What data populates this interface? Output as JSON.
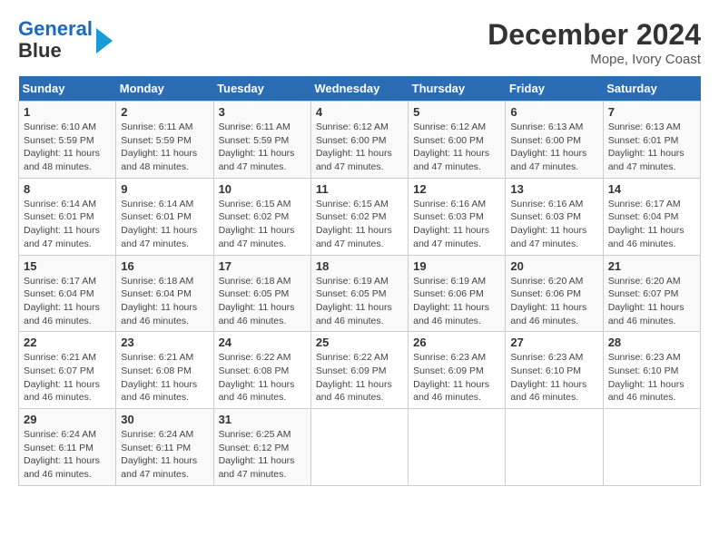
{
  "logo": {
    "line1": "General",
    "line2": "Blue"
  },
  "title": "December 2024",
  "subtitle": "Mope, Ivory Coast",
  "days_header": [
    "Sunday",
    "Monday",
    "Tuesday",
    "Wednesday",
    "Thursday",
    "Friday",
    "Saturday"
  ],
  "weeks": [
    [
      {
        "num": "1",
        "sunrise": "Sunrise: 6:10 AM",
        "sunset": "Sunset: 5:59 PM",
        "daylight": "Daylight: 11 hours and 48 minutes."
      },
      {
        "num": "2",
        "sunrise": "Sunrise: 6:11 AM",
        "sunset": "Sunset: 5:59 PM",
        "daylight": "Daylight: 11 hours and 48 minutes."
      },
      {
        "num": "3",
        "sunrise": "Sunrise: 6:11 AM",
        "sunset": "Sunset: 5:59 PM",
        "daylight": "Daylight: 11 hours and 47 minutes."
      },
      {
        "num": "4",
        "sunrise": "Sunrise: 6:12 AM",
        "sunset": "Sunset: 6:00 PM",
        "daylight": "Daylight: 11 hours and 47 minutes."
      },
      {
        "num": "5",
        "sunrise": "Sunrise: 6:12 AM",
        "sunset": "Sunset: 6:00 PM",
        "daylight": "Daylight: 11 hours and 47 minutes."
      },
      {
        "num": "6",
        "sunrise": "Sunrise: 6:13 AM",
        "sunset": "Sunset: 6:00 PM",
        "daylight": "Daylight: 11 hours and 47 minutes."
      },
      {
        "num": "7",
        "sunrise": "Sunrise: 6:13 AM",
        "sunset": "Sunset: 6:01 PM",
        "daylight": "Daylight: 11 hours and 47 minutes."
      }
    ],
    [
      {
        "num": "8",
        "sunrise": "Sunrise: 6:14 AM",
        "sunset": "Sunset: 6:01 PM",
        "daylight": "Daylight: 11 hours and 47 minutes."
      },
      {
        "num": "9",
        "sunrise": "Sunrise: 6:14 AM",
        "sunset": "Sunset: 6:01 PM",
        "daylight": "Daylight: 11 hours and 47 minutes."
      },
      {
        "num": "10",
        "sunrise": "Sunrise: 6:15 AM",
        "sunset": "Sunset: 6:02 PM",
        "daylight": "Daylight: 11 hours and 47 minutes."
      },
      {
        "num": "11",
        "sunrise": "Sunrise: 6:15 AM",
        "sunset": "Sunset: 6:02 PM",
        "daylight": "Daylight: 11 hours and 47 minutes."
      },
      {
        "num": "12",
        "sunrise": "Sunrise: 6:16 AM",
        "sunset": "Sunset: 6:03 PM",
        "daylight": "Daylight: 11 hours and 47 minutes."
      },
      {
        "num": "13",
        "sunrise": "Sunrise: 6:16 AM",
        "sunset": "Sunset: 6:03 PM",
        "daylight": "Daylight: 11 hours and 47 minutes."
      },
      {
        "num": "14",
        "sunrise": "Sunrise: 6:17 AM",
        "sunset": "Sunset: 6:04 PM",
        "daylight": "Daylight: 11 hours and 46 minutes."
      }
    ],
    [
      {
        "num": "15",
        "sunrise": "Sunrise: 6:17 AM",
        "sunset": "Sunset: 6:04 PM",
        "daylight": "Daylight: 11 hours and 46 minutes."
      },
      {
        "num": "16",
        "sunrise": "Sunrise: 6:18 AM",
        "sunset": "Sunset: 6:04 PM",
        "daylight": "Daylight: 11 hours and 46 minutes."
      },
      {
        "num": "17",
        "sunrise": "Sunrise: 6:18 AM",
        "sunset": "Sunset: 6:05 PM",
        "daylight": "Daylight: 11 hours and 46 minutes."
      },
      {
        "num": "18",
        "sunrise": "Sunrise: 6:19 AM",
        "sunset": "Sunset: 6:05 PM",
        "daylight": "Daylight: 11 hours and 46 minutes."
      },
      {
        "num": "19",
        "sunrise": "Sunrise: 6:19 AM",
        "sunset": "Sunset: 6:06 PM",
        "daylight": "Daylight: 11 hours and 46 minutes."
      },
      {
        "num": "20",
        "sunrise": "Sunrise: 6:20 AM",
        "sunset": "Sunset: 6:06 PM",
        "daylight": "Daylight: 11 hours and 46 minutes."
      },
      {
        "num": "21",
        "sunrise": "Sunrise: 6:20 AM",
        "sunset": "Sunset: 6:07 PM",
        "daylight": "Daylight: 11 hours and 46 minutes."
      }
    ],
    [
      {
        "num": "22",
        "sunrise": "Sunrise: 6:21 AM",
        "sunset": "Sunset: 6:07 PM",
        "daylight": "Daylight: 11 hours and 46 minutes."
      },
      {
        "num": "23",
        "sunrise": "Sunrise: 6:21 AM",
        "sunset": "Sunset: 6:08 PM",
        "daylight": "Daylight: 11 hours and 46 minutes."
      },
      {
        "num": "24",
        "sunrise": "Sunrise: 6:22 AM",
        "sunset": "Sunset: 6:08 PM",
        "daylight": "Daylight: 11 hours and 46 minutes."
      },
      {
        "num": "25",
        "sunrise": "Sunrise: 6:22 AM",
        "sunset": "Sunset: 6:09 PM",
        "daylight": "Daylight: 11 hours and 46 minutes."
      },
      {
        "num": "26",
        "sunrise": "Sunrise: 6:23 AM",
        "sunset": "Sunset: 6:09 PM",
        "daylight": "Daylight: 11 hours and 46 minutes."
      },
      {
        "num": "27",
        "sunrise": "Sunrise: 6:23 AM",
        "sunset": "Sunset: 6:10 PM",
        "daylight": "Daylight: 11 hours and 46 minutes."
      },
      {
        "num": "28",
        "sunrise": "Sunrise: 6:23 AM",
        "sunset": "Sunset: 6:10 PM",
        "daylight": "Daylight: 11 hours and 46 minutes."
      }
    ],
    [
      {
        "num": "29",
        "sunrise": "Sunrise: 6:24 AM",
        "sunset": "Sunset: 6:11 PM",
        "daylight": "Daylight: 11 hours and 46 minutes."
      },
      {
        "num": "30",
        "sunrise": "Sunrise: 6:24 AM",
        "sunset": "Sunset: 6:11 PM",
        "daylight": "Daylight: 11 hours and 47 minutes."
      },
      {
        "num": "31",
        "sunrise": "Sunrise: 6:25 AM",
        "sunset": "Sunset: 6:12 PM",
        "daylight": "Daylight: 11 hours and 47 minutes."
      },
      null,
      null,
      null,
      null
    ]
  ]
}
